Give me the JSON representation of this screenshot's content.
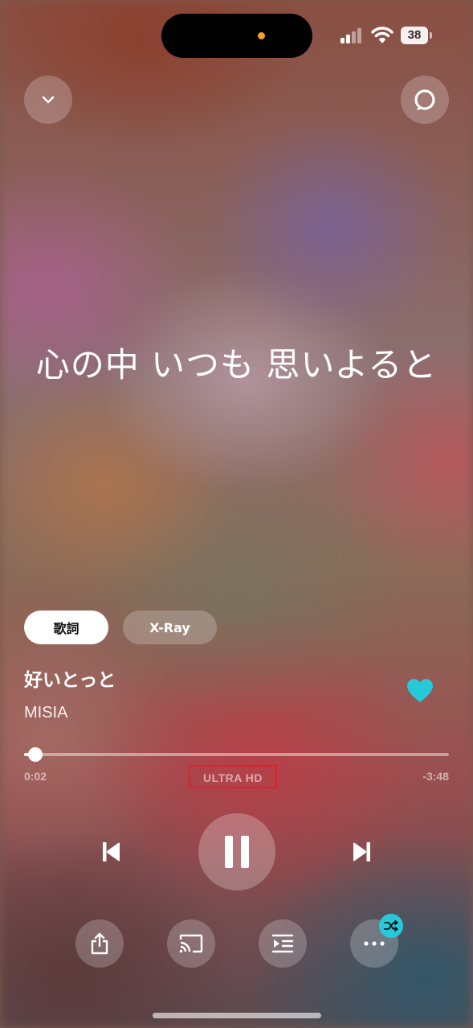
{
  "status_bar": {
    "battery_level": "38"
  },
  "header": {
    "collapse_icon": "chevron-down-icon",
    "alexa_icon": "alexa-ring-icon"
  },
  "lyrics": {
    "current_line": "心の中 いつも 思いよると"
  },
  "tabs": [
    {
      "label": "歌詞",
      "selected": true
    },
    {
      "label": "X-Ray",
      "selected": false
    }
  ],
  "track": {
    "title": "好いとっと",
    "artist": "MISIA",
    "favorite": true,
    "favorite_color": "#27c9d8"
  },
  "playback": {
    "elapsed": "0:02",
    "remaining": "-3:48",
    "progress": 0.027,
    "quality": "ULTRA HD",
    "state": "playing"
  },
  "controls": {
    "prev_icon": "skip-previous-icon",
    "pause_icon": "pause-icon",
    "next_icon": "skip-next-icon"
  },
  "actions": {
    "share_icon": "share-icon",
    "cast_icon": "cast-icon",
    "queue_icon": "queue-icon",
    "more_icon": "more-icon",
    "shuffle_icon": "shuffle-icon",
    "shuffle_on": true,
    "accent": "#27c9d8"
  }
}
